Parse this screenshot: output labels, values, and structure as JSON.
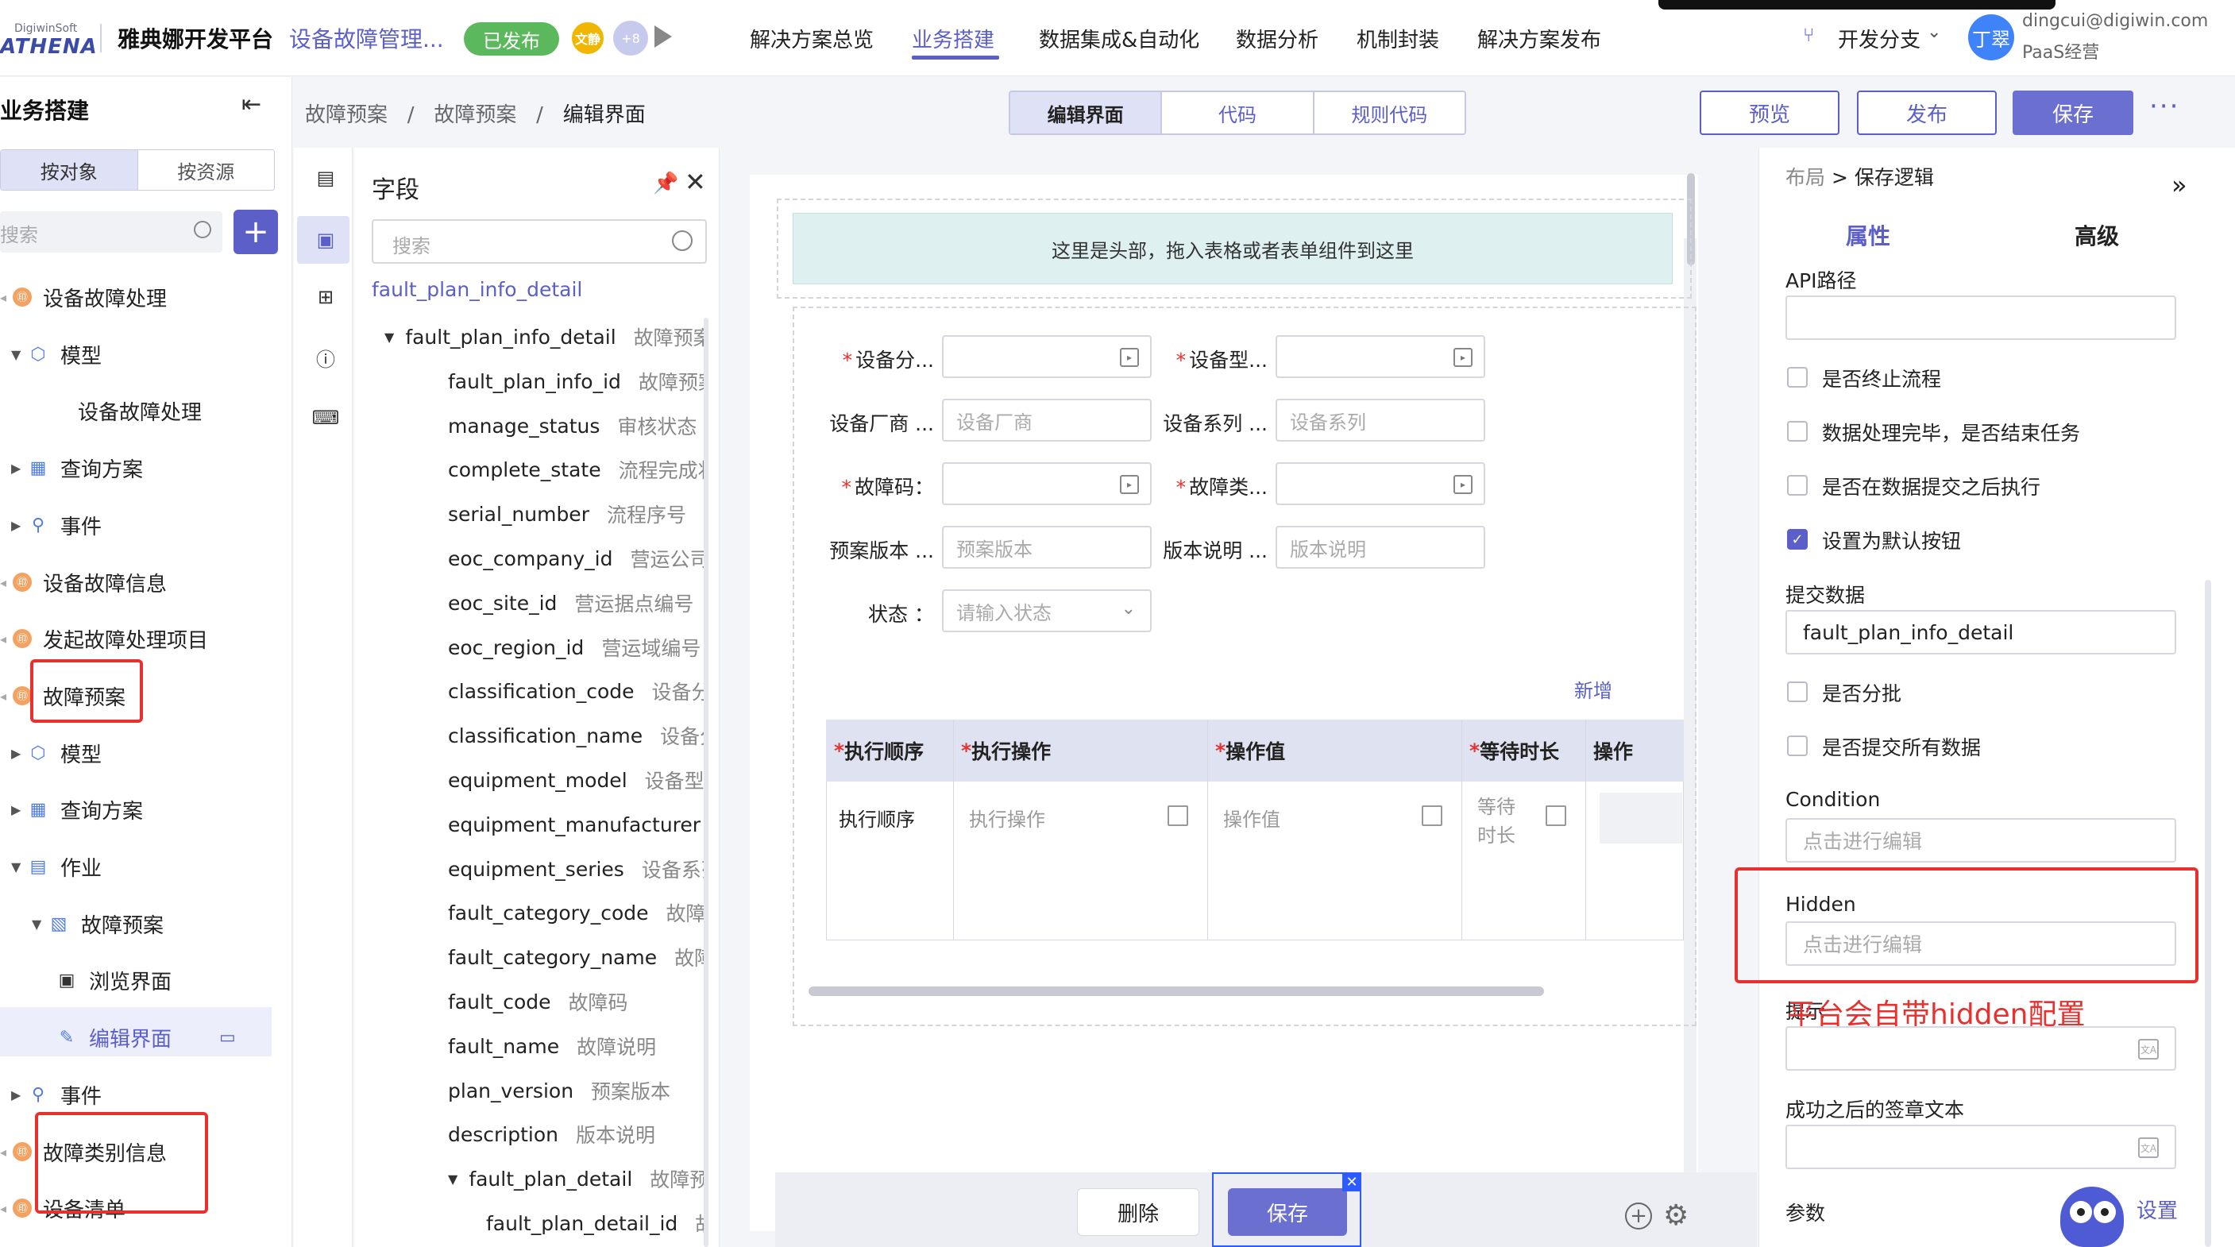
{
  "topbar": {
    "logo_small": "DigiwinSoft",
    "logo_big": "ATHENA",
    "platform": "雅典娜开发平台",
    "app_name": "设备故障管理...",
    "status": "已发布",
    "avatar_initial": "文静",
    "avatar_more": "+8",
    "nav": [
      "解决方案总览",
      "业务搭建",
      "数据集成&自动化",
      "数据分析",
      "机制封装",
      "解决方案发布"
    ],
    "active_nav": "业务搭建",
    "branch": "开发分支",
    "user_avatar": "丁翠",
    "user_email": "dingcui@digiwin.com",
    "user_org": "PaaS经营"
  },
  "sidebar": {
    "title": "业务搭建",
    "tabs": [
      "按对象",
      "按资源"
    ],
    "search_placeholder": "搜索",
    "tree": [
      {
        "label": "设备故障处理",
        "level": 0,
        "icon": "object"
      },
      {
        "label": "模型",
        "level": 1,
        "icon": "cube",
        "caret": "down"
      },
      {
        "label": "设备故障处理",
        "level": 2,
        "icon": "none"
      },
      {
        "label": "查询方案",
        "level": 1,
        "icon": "chart",
        "caret": "right"
      },
      {
        "label": "事件",
        "level": 1,
        "icon": "event",
        "caret": "right"
      },
      {
        "label": "设备故障信息",
        "level": 0,
        "icon": "object"
      },
      {
        "label": "发起故障处理项目",
        "level": 0,
        "icon": "object"
      },
      {
        "label": "故障预案",
        "level": 0,
        "icon": "object",
        "highlight": true
      },
      {
        "label": "模型",
        "level": 1,
        "icon": "cube",
        "caret": "right"
      },
      {
        "label": "查询方案",
        "level": 1,
        "icon": "chart",
        "caret": "right"
      },
      {
        "label": "作业",
        "level": 1,
        "icon": "form",
        "caret": "down"
      },
      {
        "label": "故障预案",
        "level": 2,
        "icon": "formedit",
        "caret": "down"
      },
      {
        "label": "浏览界面",
        "level": 3,
        "icon": "browse"
      },
      {
        "label": "编辑界面",
        "level": 3,
        "icon": "edit",
        "selected": true
      },
      {
        "label": "事件",
        "level": 1,
        "icon": "event",
        "caret": "right"
      },
      {
        "label": "故障类别信息",
        "level": 0,
        "icon": "object",
        "highlight": true
      },
      {
        "label": "设备清单",
        "level": 0,
        "icon": "object"
      }
    ]
  },
  "breadcrumb": [
    "故障预案",
    "故障预案",
    "编辑界面"
  ],
  "mode_tabs": [
    "编辑界面",
    "代码",
    "规则代码"
  ],
  "actions": {
    "preview": "预览",
    "publish": "发布",
    "save": "保存",
    "more": "···"
  },
  "fields": {
    "title": "字段",
    "search_placeholder": "搜索",
    "root": "fault_plan_info_detail",
    "items": [
      {
        "name": "fault_plan_info_detail",
        "desc": "故障预案",
        "indent": 0,
        "caret": true
      },
      {
        "name": "fault_plan_info_id",
        "desc": "故障预案",
        "indent": 1
      },
      {
        "name": "manage_status",
        "desc": "审核状态",
        "indent": 1
      },
      {
        "name": "complete_state",
        "desc": "流程完成状态",
        "indent": 1
      },
      {
        "name": "serial_number",
        "desc": "流程序号",
        "indent": 1
      },
      {
        "name": "eoc_company_id",
        "desc": "营运公司",
        "indent": 1
      },
      {
        "name": "eoc_site_id",
        "desc": "营运据点编号",
        "indent": 1
      },
      {
        "name": "eoc_region_id",
        "desc": "营运域编号",
        "indent": 1
      },
      {
        "name": "classification_code",
        "desc": "设备分类",
        "indent": 1
      },
      {
        "name": "classification_name",
        "desc": "设备分类",
        "indent": 1
      },
      {
        "name": "equipment_model",
        "desc": "设备型号",
        "indent": 1
      },
      {
        "name": "equipment_manufacturer",
        "desc": "",
        "indent": 1
      },
      {
        "name": "equipment_series",
        "desc": "设备系列",
        "indent": 1
      },
      {
        "name": "fault_category_code",
        "desc": "故障类别",
        "indent": 1
      },
      {
        "name": "fault_category_name",
        "desc": "故障类别",
        "indent": 1
      },
      {
        "name": "fault_code",
        "desc": "故障码",
        "indent": 1
      },
      {
        "name": "fault_name",
        "desc": "故障说明",
        "indent": 1
      },
      {
        "name": "plan_version",
        "desc": "预案版本",
        "indent": 1
      },
      {
        "name": "description",
        "desc": "版本说明",
        "indent": 1
      },
      {
        "name": "fault_plan_detail",
        "desc": "故障预案明细",
        "indent": 1,
        "caret": true
      },
      {
        "name": "fault_plan_detail_id",
        "desc": "故障",
        "indent": 2
      }
    ]
  },
  "canvas": {
    "header_drop": "这里是头部，拖入表格或者表单组件到这里",
    "form": [
      {
        "label": "设备分...",
        "required": true,
        "placeholder": "",
        "picker": true
      },
      {
        "label": "设备型...",
        "required": true,
        "placeholder": "",
        "picker": true
      },
      {
        "label": "设备厂商 ...",
        "required": false,
        "placeholder": "设备厂商"
      },
      {
        "label": "设备系列 ...",
        "required": false,
        "placeholder": "设备系列"
      },
      {
        "label": "故障码：",
        "required": true,
        "placeholder": "",
        "picker": true
      },
      {
        "label": "故障类...",
        "required": true,
        "placeholder": "",
        "picker": true
      },
      {
        "label": "预案版本 ...",
        "required": false,
        "placeholder": "预案版本"
      },
      {
        "label": "版本说明 ...",
        "required": false,
        "placeholder": "版本说明"
      },
      {
        "label": "状态 ：",
        "required": false,
        "placeholder": "请输入状态",
        "select": true
      }
    ],
    "add_new": "新增",
    "grid": {
      "headers": [
        {
          "label": "执行顺序",
          "required": true
        },
        {
          "label": "执行操作",
          "required": true
        },
        {
          "label": "操作值",
          "required": true
        },
        {
          "label": "等待时长",
          "required": true
        },
        {
          "label": "操作",
          "required": false
        }
      ],
      "row": [
        "执行顺序",
        "执行操作",
        "操作值",
        "等待时长"
      ]
    },
    "delete": "删除",
    "save": "保存"
  },
  "props": {
    "crumb_parent": "布局",
    "crumb_sep": ">",
    "crumb_current": "保存逻辑",
    "tab_attr": "属性",
    "tab_adv": "高级",
    "api_label": "API路径",
    "api_value": "",
    "checks": [
      {
        "label": "是否终止流程",
        "checked": false
      },
      {
        "label": "数据处理完毕，是否结束任务",
        "checked": false
      },
      {
        "label": "是否在数据提交之后执行",
        "checked": false
      },
      {
        "label": "设置为默认按钮",
        "checked": true
      }
    ],
    "submit_label": "提交数据",
    "submit_value": "fault_plan_info_detail",
    "checks2": [
      {
        "label": "是否分批",
        "checked": false
      },
      {
        "label": "是否提交所有数据",
        "checked": false
      }
    ],
    "condition_label": "Condition",
    "condition_ph": "点击进行编辑",
    "hidden_label": "Hidden",
    "hidden_ph": "点击进行编辑",
    "hint_label": "提示",
    "success_label": "成功之后的签章文本",
    "params_label": "参数",
    "settings_link": "设置",
    "annotation": "平台会自带hidden配置"
  },
  "colors": {
    "accent": "#5b5fc7",
    "annotation": "#e8312f",
    "published": "#5cb85c"
  }
}
